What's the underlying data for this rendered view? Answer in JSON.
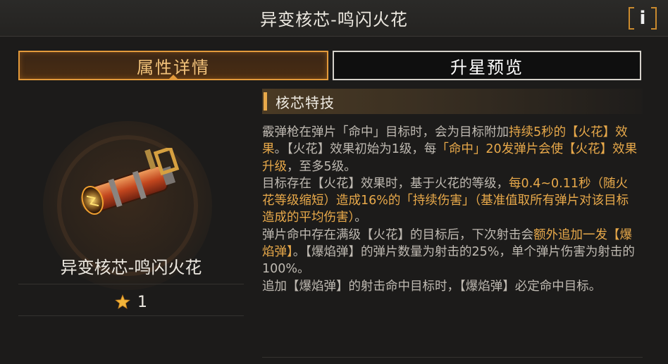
{
  "header": {
    "title": "异变核芯-鸣闪火花",
    "info_icon": "info-icon"
  },
  "tabs": [
    {
      "label": "属性详情",
      "active": true
    },
    {
      "label": "升星预览",
      "active": false
    }
  ],
  "core": {
    "name": "异变核芯-鸣闪火花",
    "star_icon": "star-icon",
    "star_count": "1"
  },
  "section": {
    "title": "核芯特技"
  },
  "description": {
    "p1": [
      {
        "text": "霰弹枪在弹片「命中」目标时，会为目标附加",
        "hl": false
      },
      {
        "text": "持续5秒的【火花】效果",
        "hl": true
      },
      {
        "text": "。【火花】效果初始为1级，每",
        "hl": false
      },
      {
        "text": "「命中」20发弹片会使【火花】效果升级",
        "hl": true
      },
      {
        "text": "，至多5级。",
        "hl": false
      }
    ],
    "p2": [
      {
        "text": "目标存在【火花】效果时，基于火花的等级，",
        "hl": false
      },
      {
        "text": "每0.4~0.11秒（随火花等级缩短）造成16%的「持续伤害」（基准值取所有弹片对该目标造成的平均伤害）",
        "hl": true
      },
      {
        "text": "。",
        "hl": false
      }
    ],
    "p3": [
      {
        "text": "弹片命中存在满级【火花】的目标后，下次射击会",
        "hl": false
      },
      {
        "text": "额外追加一发【爆焰弹】",
        "hl": true
      },
      {
        "text": "。【爆焰弹】的弹片数量为射击的25%，单个弹片伤害为射击的100%。",
        "hl": false
      }
    ],
    "p4": [
      {
        "text": "追加【爆焰弹】的射击命中目标时，【爆焰弹】必定命中目标。",
        "hl": false
      }
    ]
  },
  "colors": {
    "accent": "#e8a94a",
    "tab_active_border": "#e39a3b",
    "text_muted": "#bfbab2"
  }
}
